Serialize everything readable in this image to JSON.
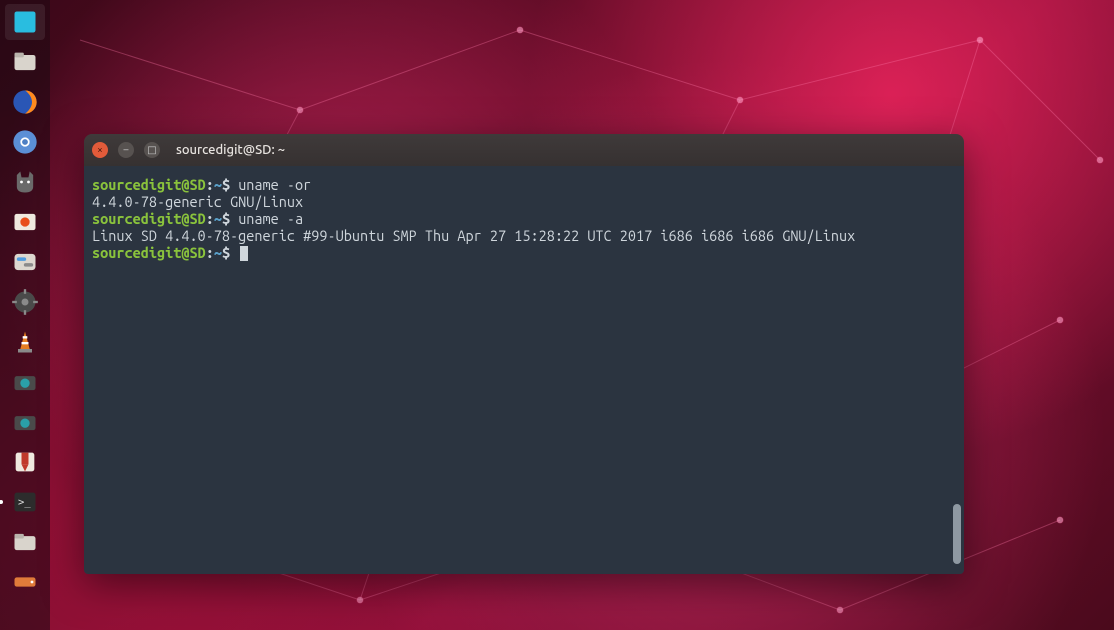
{
  "wallpaper": {
    "theme": "ubuntu-network-red"
  },
  "launcher": {
    "items": [
      {
        "name": "show-desktop",
        "icon": "desktop-icon"
      },
      {
        "name": "files",
        "icon": "files-icon"
      },
      {
        "name": "firefox",
        "icon": "firefox-icon"
      },
      {
        "name": "chromium",
        "icon": "chromium-icon"
      },
      {
        "name": "hollow-knight",
        "icon": "cat-icon"
      },
      {
        "name": "ubuntu-software",
        "icon": "software-icon"
      },
      {
        "name": "settings-panel",
        "icon": "toggles-icon"
      },
      {
        "name": "system-settings",
        "icon": "gear-icon"
      },
      {
        "name": "vlc",
        "icon": "vlc-icon"
      },
      {
        "name": "screenshot",
        "icon": "camera-icon"
      },
      {
        "name": "screenshot-alt",
        "icon": "camera-icon"
      },
      {
        "name": "transmission",
        "icon": "transmission-icon"
      },
      {
        "name": "terminal",
        "icon": "terminal-icon",
        "running": true
      },
      {
        "name": "folder",
        "icon": "folder-icon"
      },
      {
        "name": "drive",
        "icon": "drive-icon"
      }
    ]
  },
  "terminal": {
    "title": "sourcedigit@SD: ~",
    "window_controls": {
      "close": "×",
      "min": "–",
      "max": "□"
    },
    "prompt": {
      "user_host": "sourcedigit@SD",
      "colon": ":",
      "path": "~",
      "symbol": "$"
    },
    "lines": [
      {
        "type": "cmd",
        "text": "uname -or"
      },
      {
        "type": "out",
        "text": "4.4.0-78-generic GNU/Linux"
      },
      {
        "type": "cmd",
        "text": "uname -a"
      },
      {
        "type": "out",
        "text": "Linux SD 4.4.0-78-generic #99-Ubuntu SMP Thu Apr 27 15:28:22 UTC 2017 i686 i686 i686 GNU/Linux"
      },
      {
        "type": "cmd",
        "text": "",
        "cursor": true
      }
    ]
  },
  "colors": {
    "terminal_bg": "#2b3440",
    "terminal_fg": "#cfd6dc",
    "prompt_user": "#8ac33c",
    "prompt_path": "#5aa0c9",
    "titlebar": "#3a3535",
    "close_btn": "#e25b3a"
  }
}
